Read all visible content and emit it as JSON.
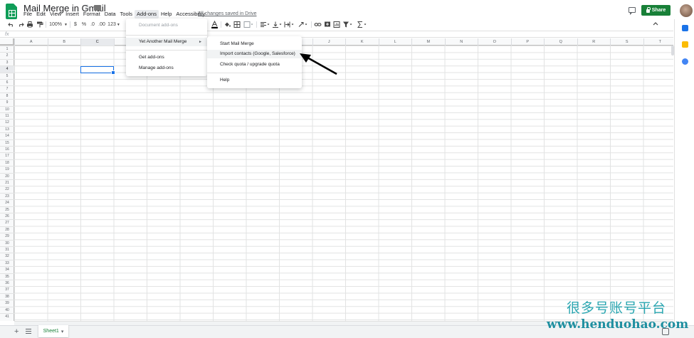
{
  "app": {
    "doc_title": "Mail Merge in Gmail",
    "star_glyph": "☆",
    "saved_status": "All changes saved in Drive",
    "share_label": "Share"
  },
  "menubar": [
    "File",
    "Edit",
    "View",
    "Insert",
    "Format",
    "Data",
    "Tools",
    "Add-ons",
    "Help",
    "Accessibility"
  ],
  "toolbar": {
    "zoom": "100%",
    "currency": "$",
    "percent": "%",
    "decimal_decrease": ".0",
    "decimal_increase": ".00",
    "number_format": "123"
  },
  "formula_bar": {
    "fx_label": "fx"
  },
  "columns": [
    "A",
    "B",
    "C",
    "D",
    "E",
    "F",
    "G",
    "H",
    "I",
    "J",
    "K",
    "L",
    "M",
    "N",
    "O",
    "P",
    "Q",
    "R",
    "S",
    "T"
  ],
  "row_count": 41,
  "selected": {
    "column": "C",
    "row": 4
  },
  "addons_menu": {
    "document_addons": "Document add-ons",
    "yamm": "Yet Another Mail Merge",
    "get_addons": "Get add-ons",
    "manage_addons": "Manage add-ons",
    "submenu_arrow": "►"
  },
  "yamm_submenu": {
    "start": "Start Mail Merge",
    "import": "Import contacts (Google, Salesforce)",
    "quota": "Check quota / upgrade quota",
    "help": "Help"
  },
  "sheet_bar": {
    "add_glyph": "+",
    "tab_label": "Sheet1",
    "tab_caret": "▾"
  },
  "watermark": {
    "chinese": "很多号账号平台",
    "url": "www.henduohao.com"
  },
  "colors": {
    "brand_green": "#0f9d58",
    "share_green": "#188038",
    "selection_blue": "#1a73e8",
    "watermark_teal": "#2aa6b1"
  }
}
